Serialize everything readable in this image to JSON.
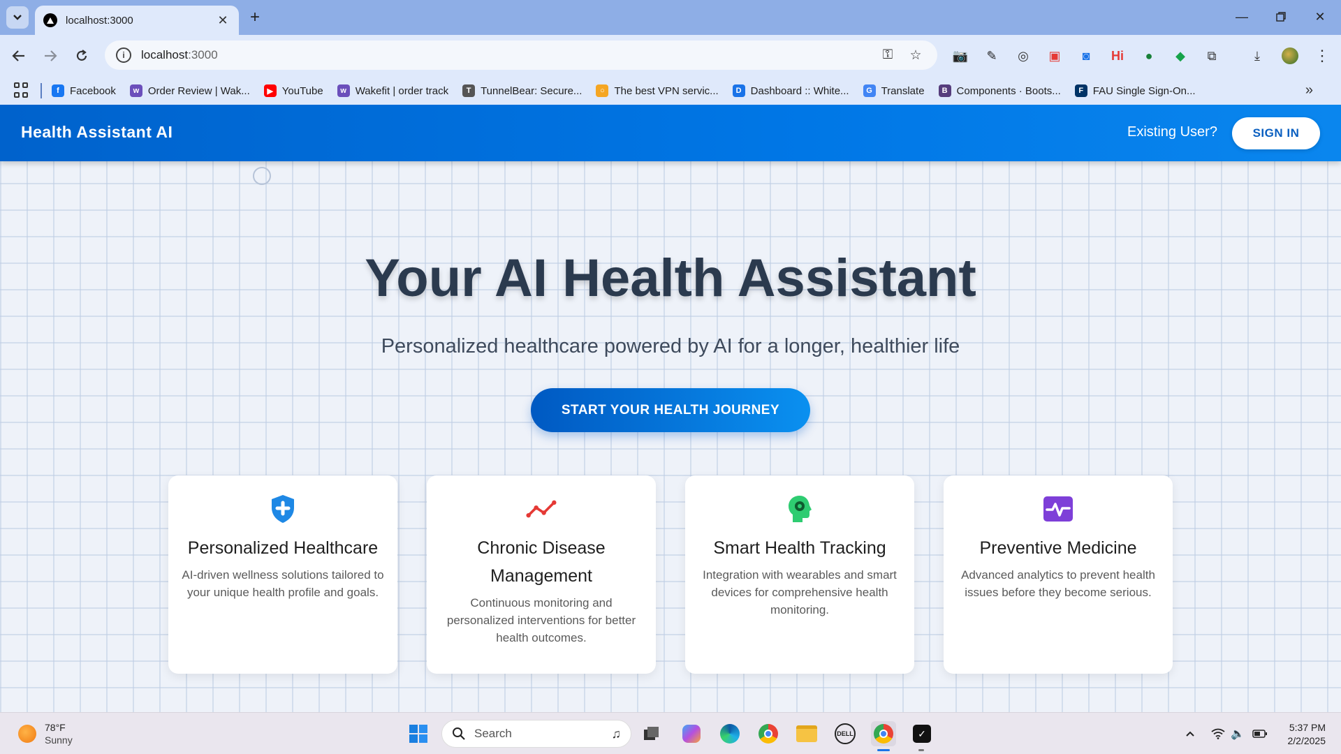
{
  "browser": {
    "tab_title": "localhost:3000",
    "url_host": "localhost",
    "url_port": ":3000",
    "bookmarks": [
      {
        "label": "Facebook",
        "color": "#1877f2",
        "glyph": "f"
      },
      {
        "label": "Order Review | Wak...",
        "color": "#6b4fbb",
        "glyph": "w"
      },
      {
        "label": "YouTube",
        "color": "#ff0000",
        "glyph": "▶"
      },
      {
        "label": "Wakefit | order track",
        "color": "#6b4fbb",
        "glyph": "w"
      },
      {
        "label": "TunnelBear: Secure...",
        "color": "#555555",
        "glyph": "T"
      },
      {
        "label": "The best VPN servic...",
        "color": "#f5a623",
        "glyph": "○"
      },
      {
        "label": "Dashboard :: White...",
        "color": "#1a73e8",
        "glyph": "D"
      },
      {
        "label": "Translate",
        "color": "#4285f4",
        "glyph": "G"
      },
      {
        "label": "Components · Boots...",
        "color": "#563d7c",
        "glyph": "B"
      },
      {
        "label": "FAU Single Sign-On...",
        "color": "#003366",
        "glyph": "F"
      }
    ]
  },
  "header": {
    "brand": "Health Assistant AI",
    "existing_user": "Existing User?",
    "signin_label": "SIGN IN"
  },
  "hero": {
    "title": "Your AI Health Assistant",
    "subtitle": "Personalized healthcare powered by AI for a longer, healthier life",
    "cta_label": "START YOUR HEALTH JOURNEY"
  },
  "features": [
    {
      "title": "Personalized Healthcare",
      "desc": "AI-driven wellness solutions tailored to your unique health profile and goals.",
      "icon": "shield-plus-icon",
      "color": "#1e88e5"
    },
    {
      "title": "Chronic Disease Management",
      "desc": "Continuous monitoring and personalized interventions for better health outcomes.",
      "icon": "trend-line-icon",
      "color": "#e53935"
    },
    {
      "title": "Smart Health Tracking",
      "desc": "Integration with wearables and smart devices for comprehensive health monitoring.",
      "icon": "head-gear-icon",
      "color": "#2ecc71"
    },
    {
      "title": "Preventive Medicine",
      "desc": "Advanced analytics to prevent health issues before they become serious.",
      "icon": "pulse-monitor-icon",
      "color": "#7e3fd8"
    }
  ],
  "taskbar": {
    "weather_temp": "78°F",
    "weather_cond": "Sunny",
    "search_label": "Search",
    "time": "5:37 PM",
    "date": "2/2/2025"
  }
}
